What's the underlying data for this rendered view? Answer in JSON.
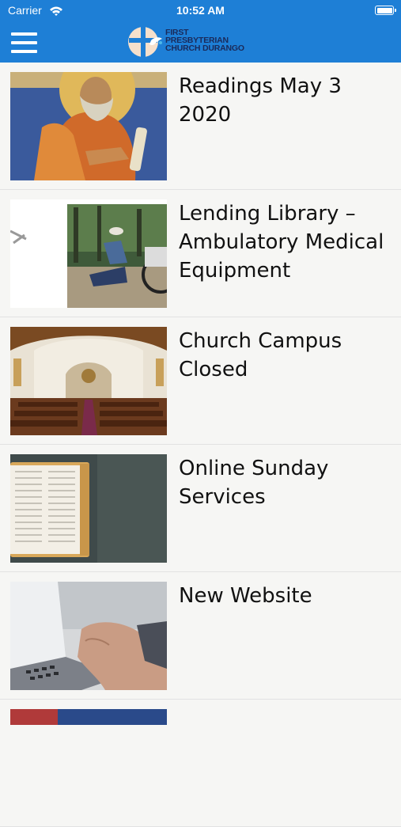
{
  "status_bar": {
    "carrier": "Carrier",
    "time": "10:52 AM"
  },
  "header": {
    "logo_lines": [
      "FIRST",
      "PRESBYTERIAN",
      "CHURCH DURANGO"
    ]
  },
  "colors": {
    "accent": "#1e7fd6",
    "logo_text": "#1a2a5a",
    "background": "#f3f3f3"
  },
  "items": [
    {
      "title": "Readings May 3 2020",
      "thumbnail": "icon-painting-image"
    },
    {
      "title": "Lending Library – Ambulatory Medical Equipment",
      "thumbnail": "wheelchair-photo"
    },
    {
      "title": "Church Campus Closed",
      "thumbnail": "church-interior-photo"
    },
    {
      "title": "Online Sunday Services",
      "thumbnail": "bible-photo"
    },
    {
      "title": "New Website",
      "thumbnail": "laptop-typing-photo"
    }
  ]
}
